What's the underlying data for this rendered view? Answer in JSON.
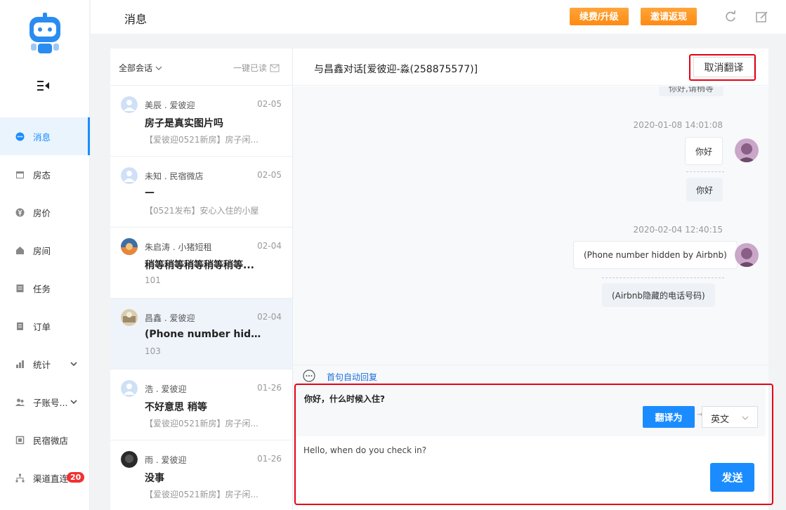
{
  "header": {
    "title": "消息",
    "renew_label": "续费/升级",
    "invite_label": "邀请返现",
    "refresh_icon": "refresh-icon",
    "edit_icon": "edit-icon"
  },
  "sidebar": {
    "items": [
      {
        "label": "消息",
        "icon": "message-icon",
        "active": true
      },
      {
        "label": "房态",
        "icon": "calendar-icon"
      },
      {
        "label": "房价",
        "icon": "yen-icon"
      },
      {
        "label": "房间",
        "icon": "house-icon"
      },
      {
        "label": "任务",
        "icon": "task-icon"
      },
      {
        "label": "订单",
        "icon": "order-icon"
      },
      {
        "label": "统计",
        "icon": "chart-icon"
      },
      {
        "label": "子账号...",
        "icon": "users-icon"
      },
      {
        "label": "民宿微店",
        "icon": "shop-icon"
      },
      {
        "label": "渠道直连",
        "icon": "channel-icon",
        "badge": "20"
      }
    ]
  },
  "conversations": {
    "filter_label": "全部会话",
    "mark_all_read": "一键已读",
    "items": [
      {
        "name": "美辰 . 爱彼迎",
        "date": "02-05",
        "message": "房子是真实图片吗",
        "sub": "【爱彼迎0521新房】房子闲..."
      },
      {
        "name": "未知 . 民宿微店",
        "date": "02-05",
        "message": "—",
        "sub": "【0521发布】安心入住的小屋"
      },
      {
        "name": "朱启涛 . 小猪短租",
        "date": "02-04",
        "message": "稍等稍等稍等稍等稍等...",
        "sub": "101"
      },
      {
        "name": "昌鑫 . 爱彼迎",
        "date": "02-04",
        "message": "(Phone number hidde...",
        "sub": "103"
      },
      {
        "name": "浩 . 爱彼迎",
        "date": "01-26",
        "message": "不好意思 稍等",
        "sub": "【爱彼迎0521新房】房子闲..."
      },
      {
        "name": "雨 . 爱彼迎",
        "date": "01-26",
        "message": "没事",
        "sub": "【爱彼迎0521新房】房子闲..."
      }
    ]
  },
  "chat": {
    "title": "与昌鑫对话[爱彼迎-淼(258875577)]",
    "cancel_translate": "取消翻译",
    "prev_snippet": "你好,请稍等",
    "messages": [
      {
        "time": "2020-01-08 14:01:08",
        "text": "你好",
        "translation": "你好"
      },
      {
        "time": "2020-02-04 12:40:15",
        "text": "(Phone number hidden by Airbnb)",
        "translation": "(Airbnb隐藏的电话号码)"
      }
    ],
    "auto_reply_label": "首句自动回复",
    "compose_text": "你好，什么时候入住?",
    "translate_button": "翻译为",
    "language": "英文",
    "translated_text": "Hello, when do you check in?",
    "send_button": "发送"
  }
}
